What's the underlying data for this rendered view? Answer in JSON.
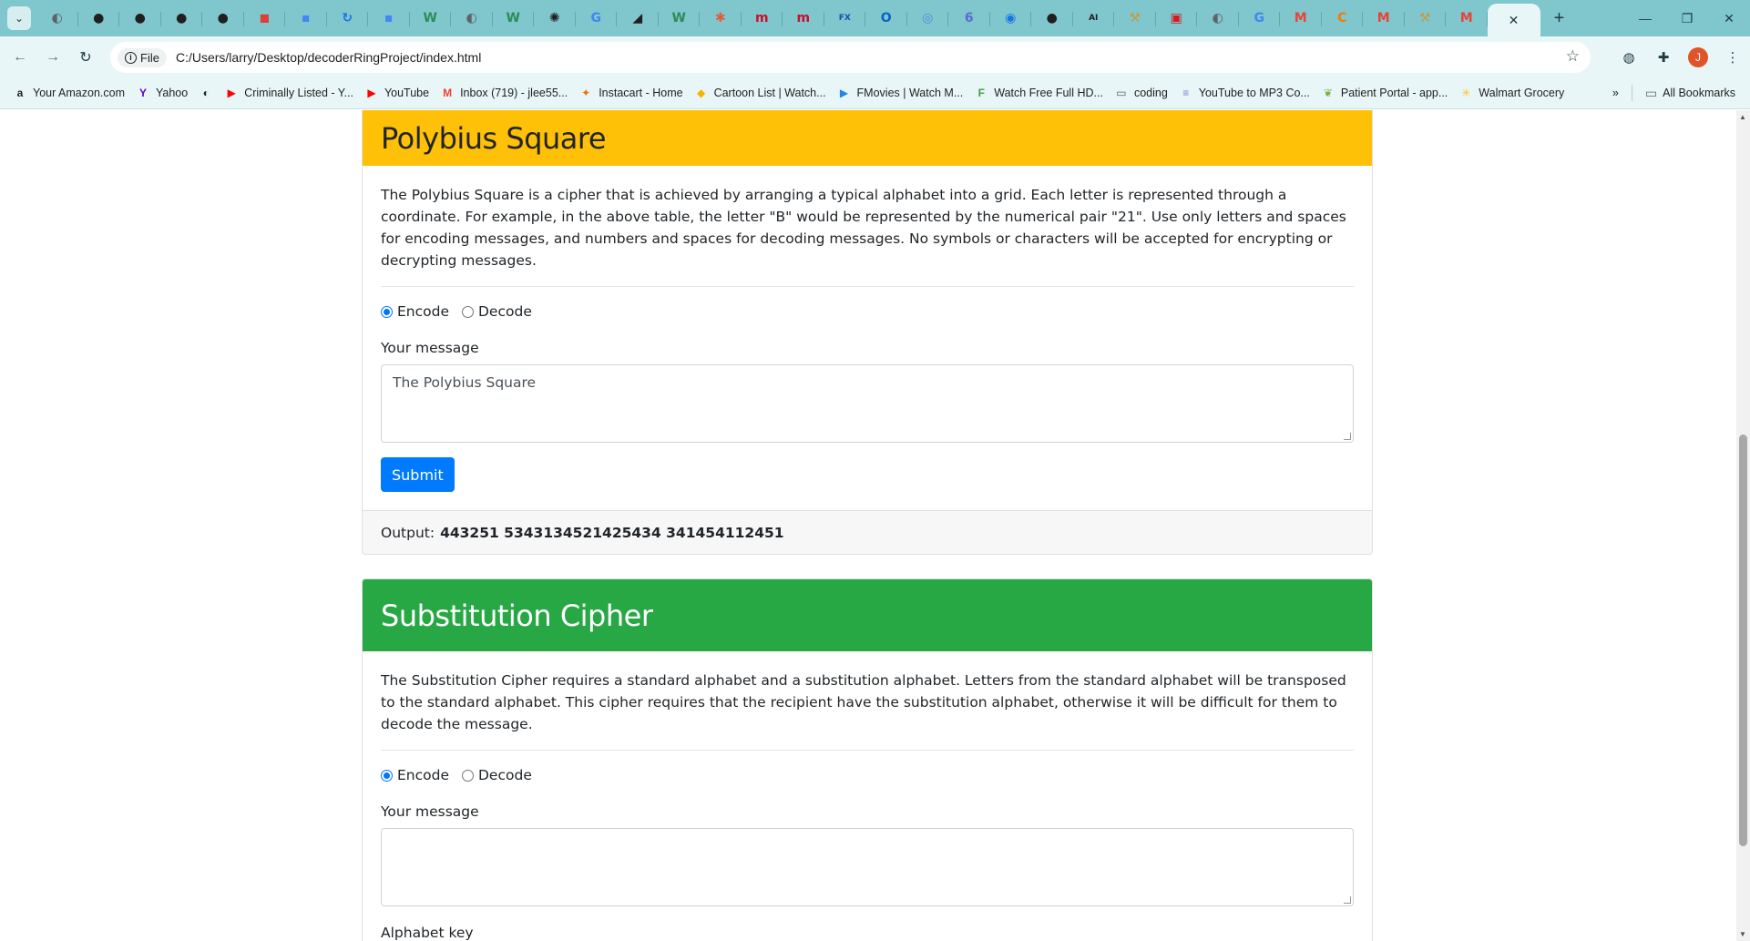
{
  "browser": {
    "tabs": [
      {
        "icon": "globe-icon",
        "color": "#5f6368",
        "glyph": "◐"
      },
      {
        "icon": "github-icon",
        "color": "#1f1f1f",
        "glyph": "●"
      },
      {
        "icon": "github-icon",
        "color": "#1f1f1f",
        "glyph": "●"
      },
      {
        "icon": "github-icon",
        "color": "#1f1f1f",
        "glyph": "●"
      },
      {
        "icon": "github-icon",
        "color": "#1f1f1f",
        "glyph": "●"
      },
      {
        "icon": "todoist-icon",
        "color": "#db4035",
        "glyph": "◼"
      },
      {
        "icon": "app-icon",
        "color": "#4285f4",
        "glyph": "▪"
      },
      {
        "icon": "refresh-icon",
        "color": "#1a73e8",
        "glyph": "↻"
      },
      {
        "icon": "app-icon",
        "color": "#4285f4",
        "glyph": "▪"
      },
      {
        "icon": "w-icon",
        "color": "#2e8b57",
        "glyph": "W"
      },
      {
        "icon": "globe-icon",
        "color": "#5f6368",
        "glyph": "◐"
      },
      {
        "icon": "w-icon",
        "color": "#2e8b57",
        "glyph": "W"
      },
      {
        "icon": "openai-icon",
        "color": "#1f1f1f",
        "glyph": "✺"
      },
      {
        "icon": "google-icon",
        "color": "#4285f4",
        "glyph": "G"
      },
      {
        "icon": "chart-icon",
        "color": "#1f1f1f",
        "glyph": "◢"
      },
      {
        "icon": "w-icon",
        "color": "#2e8b57",
        "glyph": "W"
      },
      {
        "icon": "asterisk-icon",
        "color": "#e25c3b",
        "glyph": "✱"
      },
      {
        "icon": "m-icon",
        "color": "#c8102e",
        "glyph": "m"
      },
      {
        "icon": "m-icon",
        "color": "#c8102e",
        "glyph": "m"
      },
      {
        "icon": "fx-icon",
        "color": "#1a4fa3",
        "glyph": "FX"
      },
      {
        "icon": "outlook-icon",
        "color": "#0a64c2",
        "glyph": "O"
      },
      {
        "icon": "copilot-icon",
        "color": "#4a90d9",
        "glyph": "◎"
      },
      {
        "icon": "mail-icon",
        "color": "#5b6bd1",
        "glyph": "6"
      },
      {
        "icon": "circle-icon",
        "color": "#1a73e8",
        "glyph": "◉"
      },
      {
        "icon": "github-icon",
        "color": "#1f1f1f",
        "glyph": "●"
      },
      {
        "icon": "ai-icon",
        "color": "#1f1f1f",
        "glyph": "AI"
      },
      {
        "icon": "tool-icon",
        "color": "#c79a3a",
        "glyph": "⚒"
      },
      {
        "icon": "n-icon",
        "color": "#d71920",
        "glyph": "▣"
      },
      {
        "icon": "globe-icon",
        "color": "#5f6368",
        "glyph": "◐"
      },
      {
        "icon": "google-icon",
        "color": "#4285f4",
        "glyph": "G"
      },
      {
        "icon": "gmail-icon",
        "color": "#ea4335",
        "glyph": "M"
      },
      {
        "icon": "c-icon",
        "color": "#f57c00",
        "glyph": "C"
      },
      {
        "icon": "gmail-icon",
        "color": "#ea4335",
        "glyph": "M"
      },
      {
        "icon": "tool-icon",
        "color": "#c79a3a",
        "glyph": "⚒"
      },
      {
        "icon": "gmail-icon",
        "color": "#ea4335",
        "glyph": "M"
      }
    ],
    "address": {
      "chip_label": "File",
      "url": "C:/Users/larry/Desktop/decoderRingProject/index.html"
    },
    "avatar_letter": "J",
    "bookmarks": [
      {
        "label": "Your Amazon.com",
        "icon": "amazon-icon",
        "color": "#1f1f1f",
        "glyph": "a"
      },
      {
        "label": "Yahoo",
        "icon": "yahoo-icon",
        "color": "#6001d2",
        "glyph": "Y"
      },
      {
        "label": "",
        "icon": "globe-icon",
        "color": "#1f1f1f",
        "glyph": "◐"
      },
      {
        "label": "Criminally Listed - Y...",
        "icon": "youtube-icon",
        "color": "#ff0000",
        "glyph": "▶"
      },
      {
        "label": "YouTube",
        "icon": "youtube-icon",
        "color": "#ff0000",
        "glyph": "▶"
      },
      {
        "label": "Inbox (719) - jlee55...",
        "icon": "gmail-icon",
        "color": "#ea4335",
        "glyph": "M"
      },
      {
        "label": "Instacart - Home",
        "icon": "carrot-icon",
        "color": "#f36d00",
        "glyph": "✦"
      },
      {
        "label": "Cartoon List | Watch...",
        "icon": "cartoon-icon",
        "color": "#f5b400",
        "glyph": "◆"
      },
      {
        "label": "FMovies | Watch M...",
        "icon": "play-icon",
        "color": "#1e88e5",
        "glyph": "▶"
      },
      {
        "label": "Watch Free Full HD...",
        "icon": "film-icon",
        "color": "#43a047",
        "glyph": "F"
      },
      {
        "label": "coding",
        "icon": "folder-icon",
        "color": "#5f6368",
        "glyph": "▭"
      },
      {
        "label": "YouTube to MP3 Co...",
        "icon": "converter-icon",
        "color": "#7986cb",
        "glyph": "≡"
      },
      {
        "label": "Patient Portal - app...",
        "icon": "leaf-icon",
        "color": "#7cb342",
        "glyph": "❦"
      },
      {
        "label": "Walmart Grocery",
        "icon": "walmart-icon",
        "color": "#ffc220",
        "glyph": "✳"
      }
    ],
    "all_bookmarks_label": "All Bookmarks"
  },
  "polybius": {
    "title": "Polybius Square",
    "description": "The Polybius Square is a cipher that is achieved by arranging a typical alphabet into a grid. Each letter is represented through a coordinate. For example, in the above table, the letter \"B\" would be represented by the numerical pair \"21\". Use only letters and spaces for encoding messages, and numbers and spaces for decoding messages. No symbols or characters will be accepted for encrypting or decrypting messages.",
    "encode_label": "Encode",
    "decode_label": "Decode",
    "message_label": "Your message",
    "message_value": "The Polybius Square",
    "submit_label": "Submit",
    "output_label": "Output:",
    "output_value": "443251 5343134521425434 341454112451"
  },
  "substitution": {
    "title": "Substitution Cipher",
    "description": "The Substitution Cipher requires a standard alphabet and a substitution alphabet. Letters from the standard alphabet will be transposed to the standard alphabet. This cipher requires that the recipient have the substitution alphabet, otherwise it will be difficult for them to decode the message.",
    "encode_label": "Encode",
    "decode_label": "Decode",
    "message_label": "Your message",
    "message_value": "",
    "alphabet_label": "Alphabet key"
  },
  "colors": {
    "chrome_bg": "#7fc6cd",
    "polybius_header": "#ffc107",
    "substitution_header": "#28a745",
    "primary_button": "#007bff"
  }
}
